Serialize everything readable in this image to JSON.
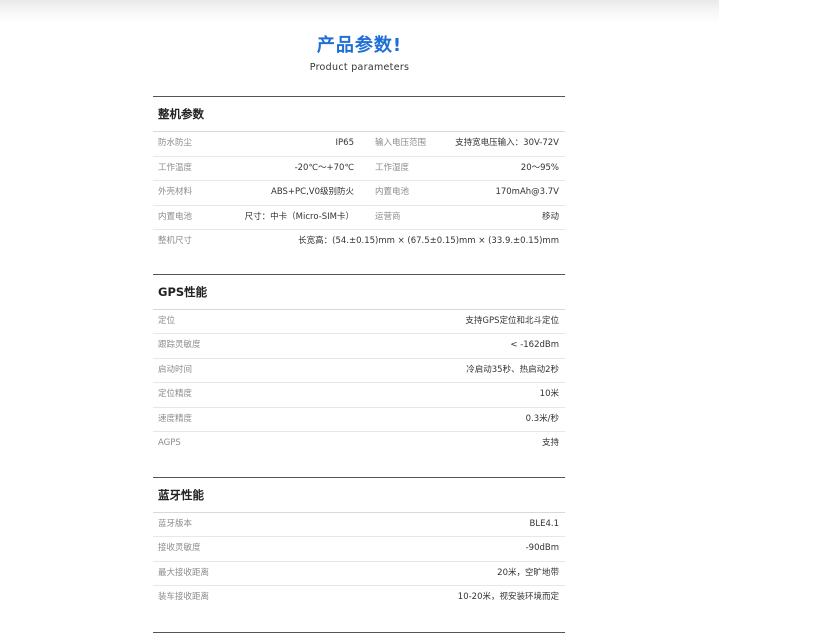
{
  "header": {
    "title": "产品参数!",
    "subtitle": "Product parameters"
  },
  "sections": [
    {
      "title": "整机参数",
      "rows": [
        {
          "l1": "防水防尘",
          "v1": "IP65",
          "l2": "输入电压范围",
          "v2": "支持宽电压输入：30V-72V"
        },
        {
          "l1": "工作温度",
          "v1": "-20℃～+70℃",
          "l2": "工作湿度",
          "v2": "20～95%"
        },
        {
          "l1": "外壳材料",
          "v1": "ABS+PC,V0级别防火",
          "l2": "内置电池",
          "v2": "170mAh@3.7V"
        },
        {
          "l1": "内置电池",
          "v1": "尺寸：中卡（Micro-SIM卡）",
          "l2": "运营商",
          "v2": "移动"
        },
        {
          "l1": "整机尺寸",
          "v1": "长宽高：(54.±0.15)mm × (67.5±0.15)mm × (33.9.±0.15)mm"
        }
      ]
    },
    {
      "title": "GPS性能",
      "rows": [
        {
          "l1": "定位",
          "v1": "支持GPS定位和北斗定位"
        },
        {
          "l1": "跟踪灵敏度",
          "v1": "< -162dBm"
        },
        {
          "l1": "启动时间",
          "v1": "冷启动35秒、热启动2秒"
        },
        {
          "l1": "定位精度",
          "v1": "10米"
        },
        {
          "l1": "速度精度",
          "v1": "0.3米/秒"
        },
        {
          "l1": "AGPS",
          "v1": "支持"
        }
      ]
    },
    {
      "title": "蓝牙性能",
      "rows": [
        {
          "l1": "蓝牙版本",
          "v1": "BLE4.1"
        },
        {
          "l1": "接收灵敏度",
          "v1": "-90dBm"
        },
        {
          "l1": "最大接收距离",
          "v1": "20米，空旷地带"
        },
        {
          "l1": "装车接收距离",
          "v1": "10-20米，视安装环境而定"
        }
      ]
    }
  ]
}
